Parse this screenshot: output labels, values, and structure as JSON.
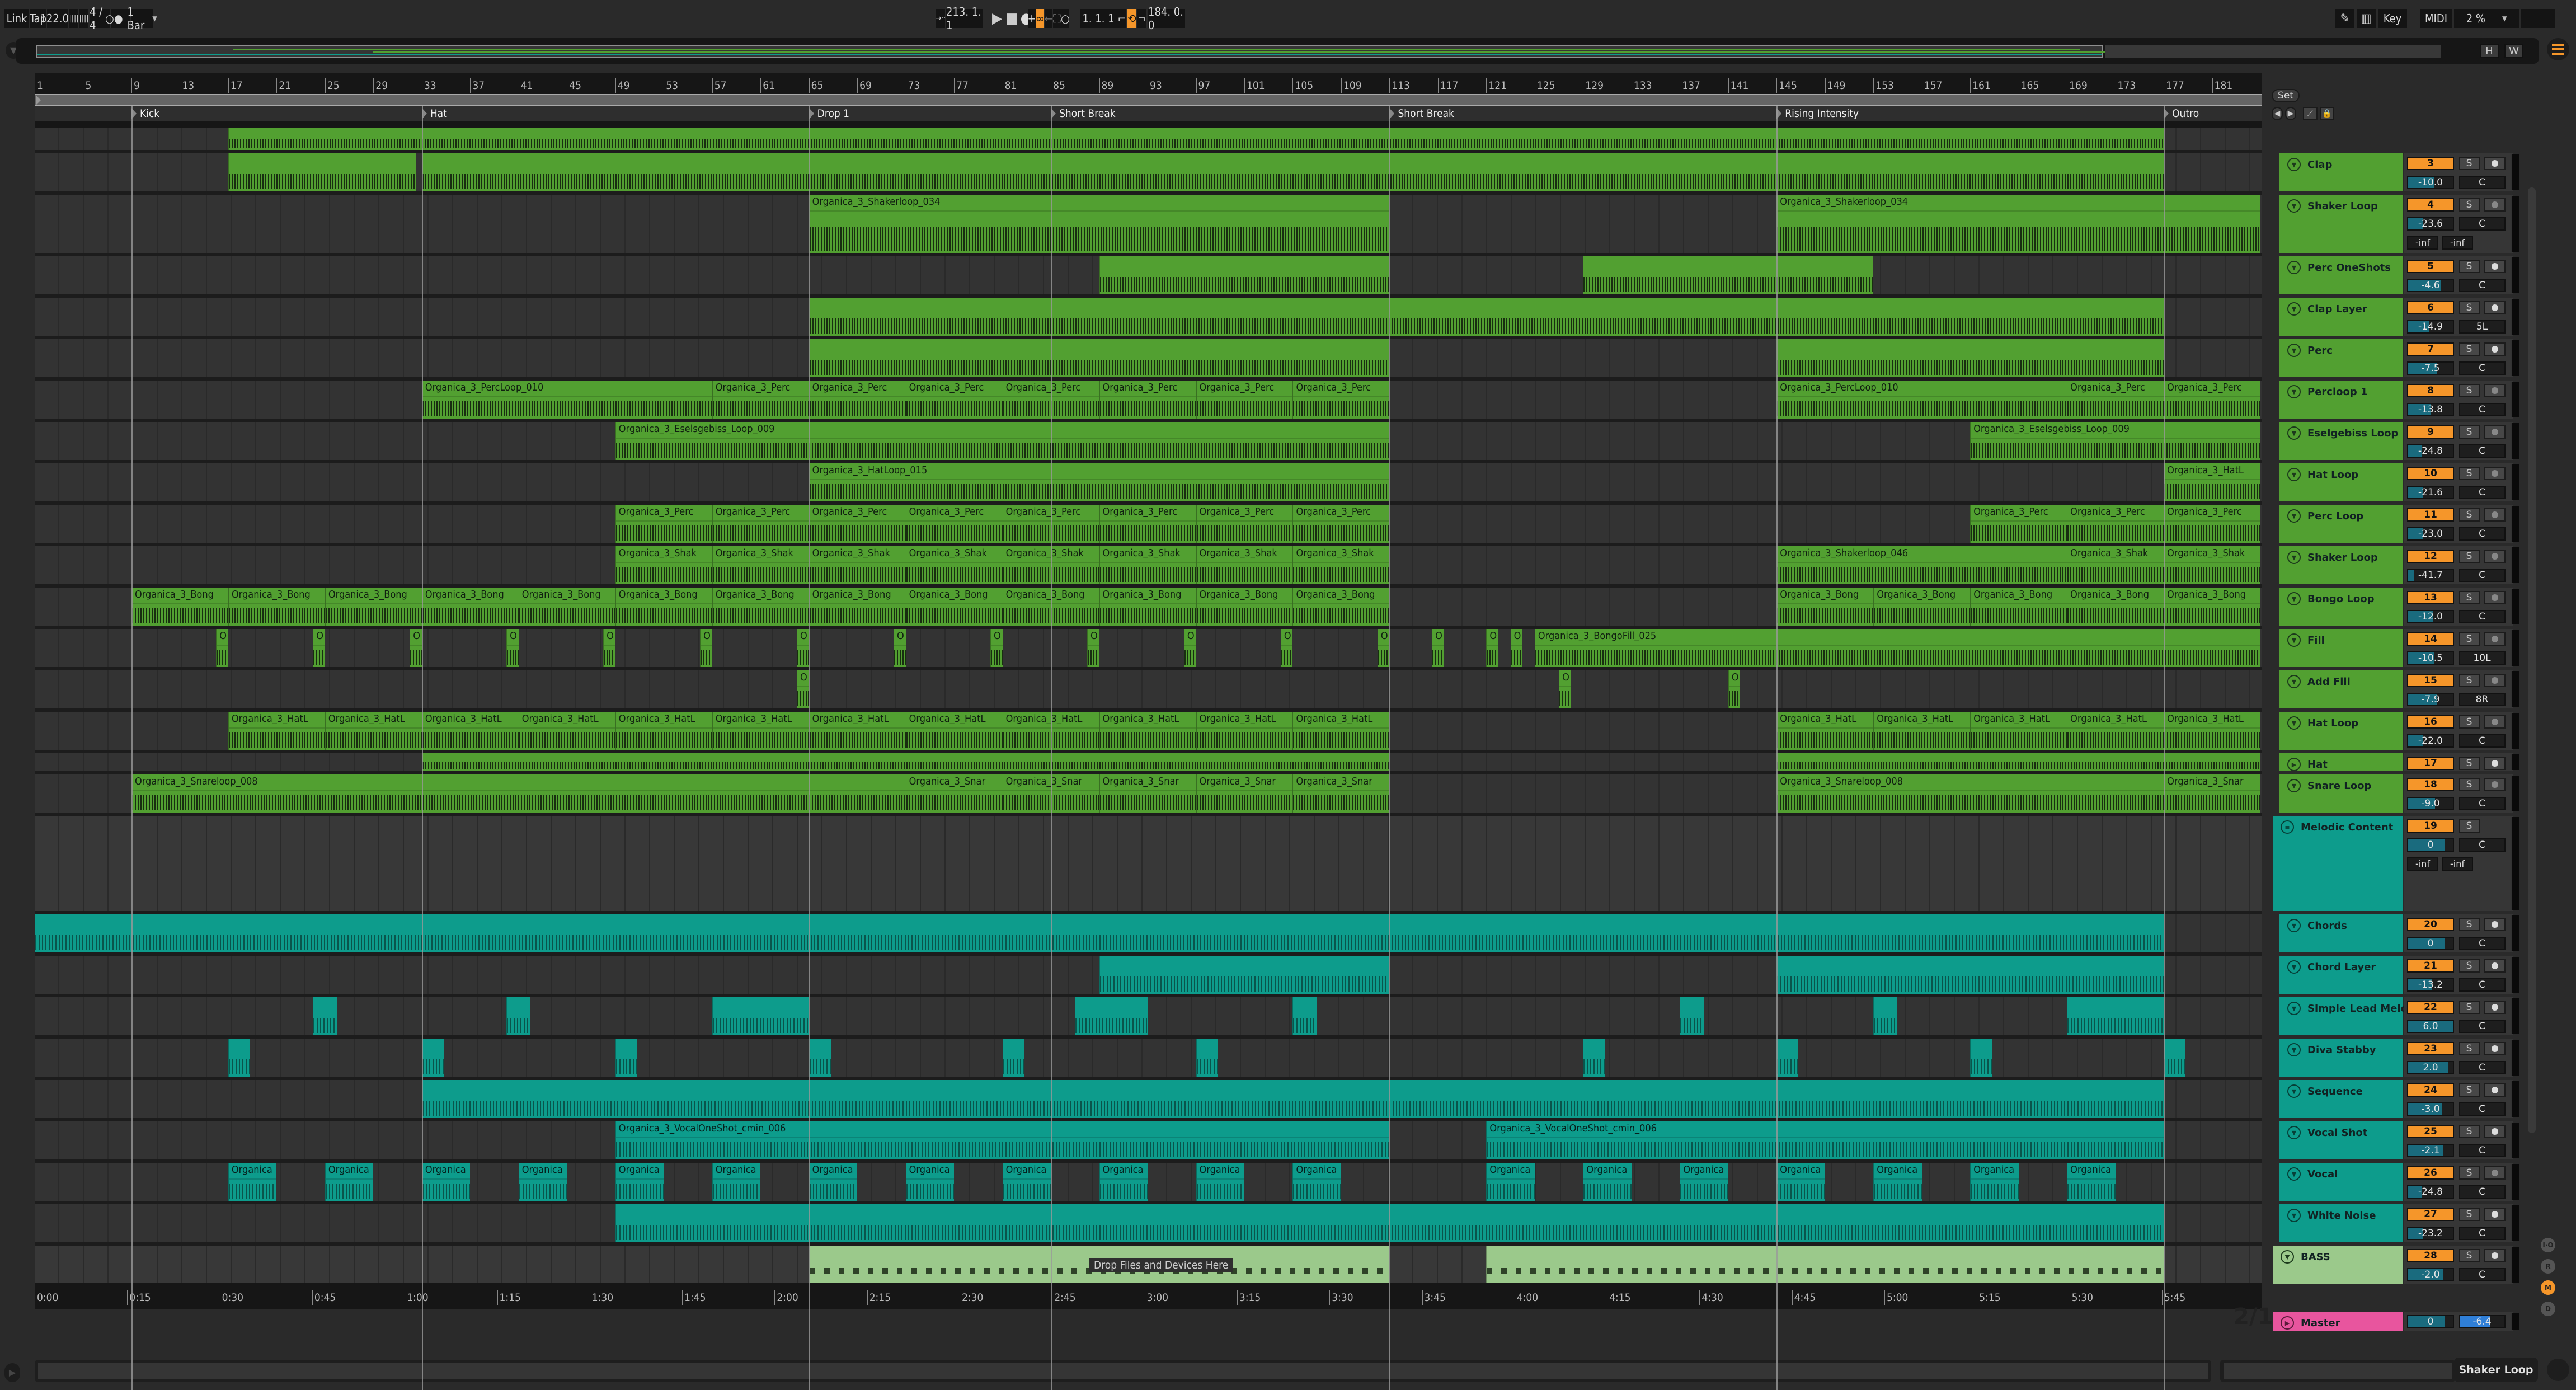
{
  "control_bar": {
    "link": "Link",
    "tap": "Tap",
    "tempo": "122.00",
    "nudge_down": "||||",
    "nudge_up": "||||",
    "time_signature": "4 / 4",
    "metronome": "○●",
    "quantization": "1 Bar",
    "follow_label": "→··",
    "song_position": "213.  1.  1",
    "play_icon": "▶",
    "stop_icon": "■",
    "record_icon": "●",
    "overdub": "+",
    "automation_arm": "∞",
    "back_to_arrangement": "←",
    "capture": "⛶",
    "session_record": "○",
    "loop_start": "1.  1.  1",
    "punch_in": "⌐",
    "loop_switch": "⟲",
    "punch_out": "¬",
    "loop_length": "184.  0.  0",
    "draw_mode": "✎",
    "keyboard": "▥",
    "key": "Key",
    "midi": "MIDI",
    "cpu_load": "2 %",
    "hide_label": "H",
    "width_label": "W"
  },
  "ruler": {
    "bars": [
      "1",
      "5",
      "9",
      "13",
      "17",
      "21",
      "25",
      "29",
      "33",
      "37",
      "41",
      "45",
      "49",
      "53",
      "57",
      "61",
      "65",
      "69",
      "73",
      "77",
      "81",
      "85",
      "89",
      "93",
      "97",
      "101",
      "105",
      "109",
      "113",
      "117",
      "121",
      "125",
      "129",
      "133",
      "137",
      "141",
      "145",
      "149",
      "153",
      "157",
      "161",
      "165",
      "169",
      "173",
      "177",
      "181"
    ],
    "times": [
      "0:00",
      "0:15",
      "0:30",
      "0:45",
      "1:00",
      "1:15",
      "1:30",
      "1:45",
      "2:00",
      "2:15",
      "2:30",
      "2:45",
      "3:00",
      "3:15",
      "3:30",
      "3:45",
      "4:00",
      "4:15",
      "4:30",
      "4:45",
      "5:00",
      "5:15",
      "5:30",
      "5:45"
    ]
  },
  "locators": [
    {
      "name": "Kick",
      "bar": 9
    },
    {
      "name": "Hat",
      "bar": 33
    },
    {
      "name": "Drop 1",
      "bar": 65
    },
    {
      "name": "Short Break",
      "bar": 85
    },
    {
      "name": "Short Break",
      "bar": 113
    },
    {
      "name": "Rising Intensity",
      "bar": 145
    },
    {
      "name": "Outro",
      "bar": 177
    }
  ],
  "set_panel": {
    "set": "Set",
    "prev": "◀",
    "next": "▶",
    "curve": "⟋",
    "lock": "🔒"
  },
  "tracks": [
    {
      "name": "Clap",
      "num": "3",
      "vol": "-10.0",
      "vol_frac": 0.58,
      "pan": "C",
      "arm": "clock",
      "color": "green"
    },
    {
      "name": "Shaker Loop",
      "num": "4",
      "vol": "-23.6",
      "vol_frac": 0.32,
      "pan": "C",
      "arm": "dot",
      "color": "green",
      "meters": [
        "-inf",
        "-inf"
      ]
    },
    {
      "name": "Perc OneShots",
      "num": "5",
      "vol": "-4.6",
      "vol_frac": 0.72,
      "pan": "C",
      "arm": "clock",
      "color": "green"
    },
    {
      "name": "Clap Layer",
      "num": "6",
      "vol": "-14.9",
      "vol_frac": 0.47,
      "pan": "5L",
      "arm": "clock",
      "color": "green"
    },
    {
      "name": "Perc",
      "num": "7",
      "vol": "-7.5",
      "vol_frac": 0.65,
      "pan": "C",
      "arm": "clock",
      "color": "green"
    },
    {
      "name": "Percloop 1",
      "num": "8",
      "vol": "-13.8",
      "vol_frac": 0.5,
      "pan": "C",
      "arm": "dot",
      "color": "green"
    },
    {
      "name": "Eselgebiss Loop",
      "num": "9",
      "vol": "-24.8",
      "vol_frac": 0.3,
      "pan": "C",
      "arm": "dot",
      "color": "green"
    },
    {
      "name": "Hat Loop",
      "num": "10",
      "vol": "-21.6",
      "vol_frac": 0.34,
      "pan": "C",
      "arm": "dot",
      "color": "green"
    },
    {
      "name": "Perc Loop",
      "num": "11",
      "vol": "-23.0",
      "vol_frac": 0.32,
      "pan": "C",
      "arm": "dot",
      "color": "green"
    },
    {
      "name": "Shaker Loop",
      "num": "12",
      "vol": "-41.7",
      "vol_frac": 0.14,
      "pan": "C",
      "arm": "dot",
      "color": "green"
    },
    {
      "name": "Bongo Loop",
      "num": "13",
      "vol": "-12.0",
      "vol_frac": 0.55,
      "pan": "C",
      "arm": "dot",
      "color": "green"
    },
    {
      "name": "Fill",
      "num": "14",
      "vol": "-10.5",
      "vol_frac": 0.58,
      "pan": "10L",
      "arm": "dot",
      "color": "green"
    },
    {
      "name": "Add Fill",
      "num": "15",
      "vol": "-7.9",
      "vol_frac": 0.64,
      "pan": "8R",
      "arm": "dot",
      "color": "green"
    },
    {
      "name": "Hat Loop",
      "num": "16",
      "vol": "-22.0",
      "vol_frac": 0.32,
      "pan": "C",
      "arm": "dot",
      "color": "green"
    },
    {
      "name": "Hat",
      "num": "17",
      "vol": "",
      "vol_frac": 0,
      "pan": "",
      "arm": "clock",
      "color": "green",
      "collapsed": true
    },
    {
      "name": "Snare Loop",
      "num": "18",
      "vol": "-9.0",
      "vol_frac": 0.6,
      "pan": "C",
      "arm": "dot",
      "color": "green"
    },
    {
      "name": "Melodic Content",
      "num": "19",
      "vol": "0",
      "vol_frac": 0.82,
      "pan": "C",
      "arm": "none",
      "color": "teal",
      "group": true,
      "meters": [
        "-inf",
        "-inf"
      ]
    },
    {
      "name": "Chords",
      "num": "20",
      "vol": "0",
      "vol_frac": 0.82,
      "pan": "C",
      "arm": "clock",
      "color": "teal"
    },
    {
      "name": "Chord Layer",
      "num": "21",
      "vol": "-13.2",
      "vol_frac": 0.52,
      "pan": "C",
      "arm": "clock",
      "color": "teal"
    },
    {
      "name": "Simple Lead Melo",
      "num": "22",
      "vol": "6.0",
      "vol_frac": 1.0,
      "pan": "C",
      "arm": "clock",
      "color": "teal"
    },
    {
      "name": "Diva Stabby",
      "num": "23",
      "vol": "2.0",
      "vol_frac": 0.9,
      "pan": "C",
      "arm": "clock",
      "color": "teal"
    },
    {
      "name": "Sequence",
      "num": "24",
      "vol": "-3.0",
      "vol_frac": 0.76,
      "pan": "C",
      "arm": "clock",
      "color": "teal"
    },
    {
      "name": "Vocal Shot",
      "num": "25",
      "vol": "-2.1",
      "vol_frac": 0.78,
      "pan": "C",
      "arm": "clock",
      "color": "teal"
    },
    {
      "name": "Vocal",
      "num": "26",
      "vol": "-24.8",
      "vol_frac": 0.3,
      "pan": "C",
      "arm": "dot",
      "color": "teal"
    },
    {
      "name": "White Noise",
      "num": "27",
      "vol": "-23.2",
      "vol_frac": 0.32,
      "pan": "C",
      "arm": "clock",
      "color": "teal"
    },
    {
      "name": "BASS",
      "num": "28",
      "vol": "-2.0",
      "vol_frac": 0.78,
      "pan": "C",
      "arm": "clock",
      "color": "bass",
      "group": true
    }
  ],
  "master": {
    "name": "Master",
    "vol": "0",
    "vol_frac": 0.82,
    "pan": "-6.4",
    "pan_frac": 0.68
  },
  "clips": {
    "shakerloop_034": "Organica_3_Shakerloop_034",
    "percloop_010": "Organica_3_PercLoop_010",
    "perc_short": "Organica_3_Perc",
    "eselsgebiss": "Organica_3_Eselsgebiss_Loop_009",
    "hatloop_015": "Organica_3_HatLoop_015",
    "shak_short": "Organica_3_Shak",
    "shakerloop_046": "Organica_3_Shakerloop_046",
    "bong_short": "Organica_3_Bong",
    "bongofill_025": "Organica_3_BongoFill_025",
    "hatl_short": "Organica_3_HatL",
    "snareloop_008": "Organica_3_Snareloop_008",
    "snar_short": "Organica_3_Snar",
    "vocaloneshot": "Organica_3_VocalOneShot_cmin_006",
    "organica_short": "Organica",
    "oneshot_short": "O"
  },
  "drop_hint": "Drop Files and Devices Here",
  "zoom_label": "2/1",
  "io_buttons": [
    "I·O",
    "R",
    "M",
    "D"
  ],
  "status": {
    "selected_track": "Shaker Loop"
  },
  "colors": {
    "accent": "#f5962a",
    "drums": "#52a031",
    "melodic": "#0d9c8c",
    "bass": "#9bc98b",
    "master": "#e8559e",
    "volume": "#1a6b7e"
  }
}
